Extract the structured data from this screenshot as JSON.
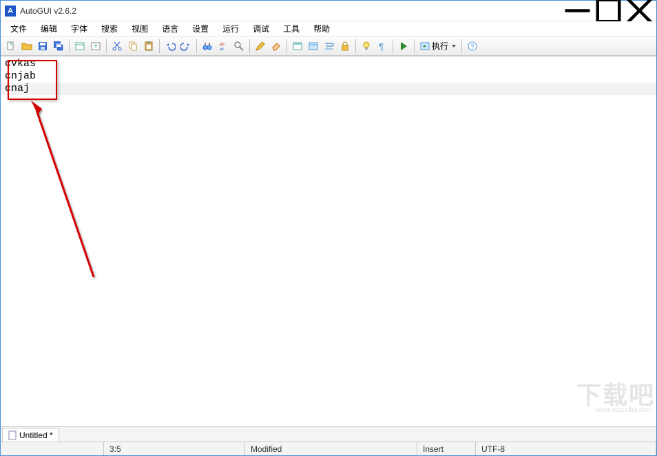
{
  "window": {
    "title": "AutoGUI v2.6.2",
    "icon_letter": "A"
  },
  "menus": [
    "文件",
    "编辑",
    "字体",
    "搜索",
    "视图",
    "语言",
    "设置",
    "运行",
    "调试",
    "工具",
    "帮助"
  ],
  "toolbar": {
    "run_label": "执行"
  },
  "editor": {
    "lines": [
      "cvkas",
      "cnjab",
      "cnaj"
    ],
    "current_line_index": 2
  },
  "tab": {
    "label": "Untitled *"
  },
  "status": {
    "cursor": "3:5",
    "modified": "Modified",
    "mode": "Insert",
    "encoding": "UTF-8"
  },
  "watermark": {
    "main": "下载吧",
    "sub": "www.xiazaiba.com"
  }
}
